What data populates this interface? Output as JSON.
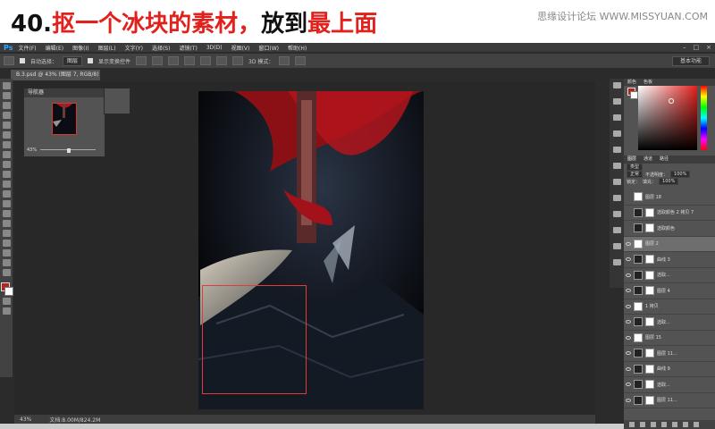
{
  "banner": {
    "step_number": "40.",
    "title_red_1": "抠一个冰块的素材，",
    "title_black": "放到",
    "title_red_2": "最上面",
    "site": "思缘设计论坛 WWW.MISSYUAN.COM"
  },
  "ps": {
    "logo": "Ps",
    "menu": [
      "文件(F)",
      "编辑(E)",
      "图像(I)",
      "图层(L)",
      "文字(Y)",
      "选择(S)",
      "滤镜(T)",
      "3D(D)",
      "视图(V)",
      "窗口(W)",
      "帮助(H)"
    ],
    "options": {
      "auto_select_label": "自动选择：",
      "auto_select_value": "图层",
      "show_transform": "显示变换控件",
      "mode_3d": "3D 模式：",
      "workspace": "基本功能"
    },
    "doc_tab": "B.3.psd @ 43% (图层 7, RGB/8) *",
    "navigator": {
      "title": "导航器",
      "zoom": "43%"
    },
    "status": {
      "zoom": "43%",
      "doc": "文档:8.00M/824.2M"
    },
    "color_panel": {
      "tabs": [
        "颜色",
        "色板"
      ],
      "fg_color": "#b3241d",
      "bg_color": "#ffffff"
    },
    "layers_panel": {
      "tabs": [
        "图层",
        "通道",
        "路径"
      ],
      "kind_label": "类型",
      "blend_mode": "正常",
      "opacity_label": "不透明度：",
      "opacity_value": "100%",
      "lock_label": "锁定：",
      "fill_label": "填充：",
      "fill_value": "100%",
      "layers": [
        {
          "name": "图层 18",
          "visible": false,
          "selected": false,
          "mask": false
        },
        {
          "name": "选取颜色 2 拷贝 7",
          "visible": false,
          "selected": false,
          "mask": true
        },
        {
          "name": "选取颜色",
          "visible": false,
          "selected": false,
          "mask": true
        },
        {
          "name": "图层 2",
          "visible": true,
          "selected": true,
          "mask": false
        },
        {
          "name": "曲线 3",
          "visible": true,
          "selected": false,
          "mask": true
        },
        {
          "name": "选取...",
          "visible": true,
          "selected": false,
          "mask": true
        },
        {
          "name": "图层 4",
          "visible": true,
          "selected": false,
          "mask": true
        },
        {
          "name": "1 拷贝",
          "visible": true,
          "selected": false,
          "mask": false
        },
        {
          "name": "选取...",
          "visible": true,
          "selected": false,
          "mask": true
        },
        {
          "name": "图层 15",
          "visible": true,
          "selected": false,
          "mask": false
        },
        {
          "name": "图层 11...",
          "visible": true,
          "selected": false,
          "mask": true
        },
        {
          "name": "曲线 9",
          "visible": true,
          "selected": false,
          "mask": true
        },
        {
          "name": "选取...",
          "visible": true,
          "selected": false,
          "mask": true
        },
        {
          "name": "图层 11...",
          "visible": true,
          "selected": false,
          "mask": true
        }
      ]
    }
  }
}
